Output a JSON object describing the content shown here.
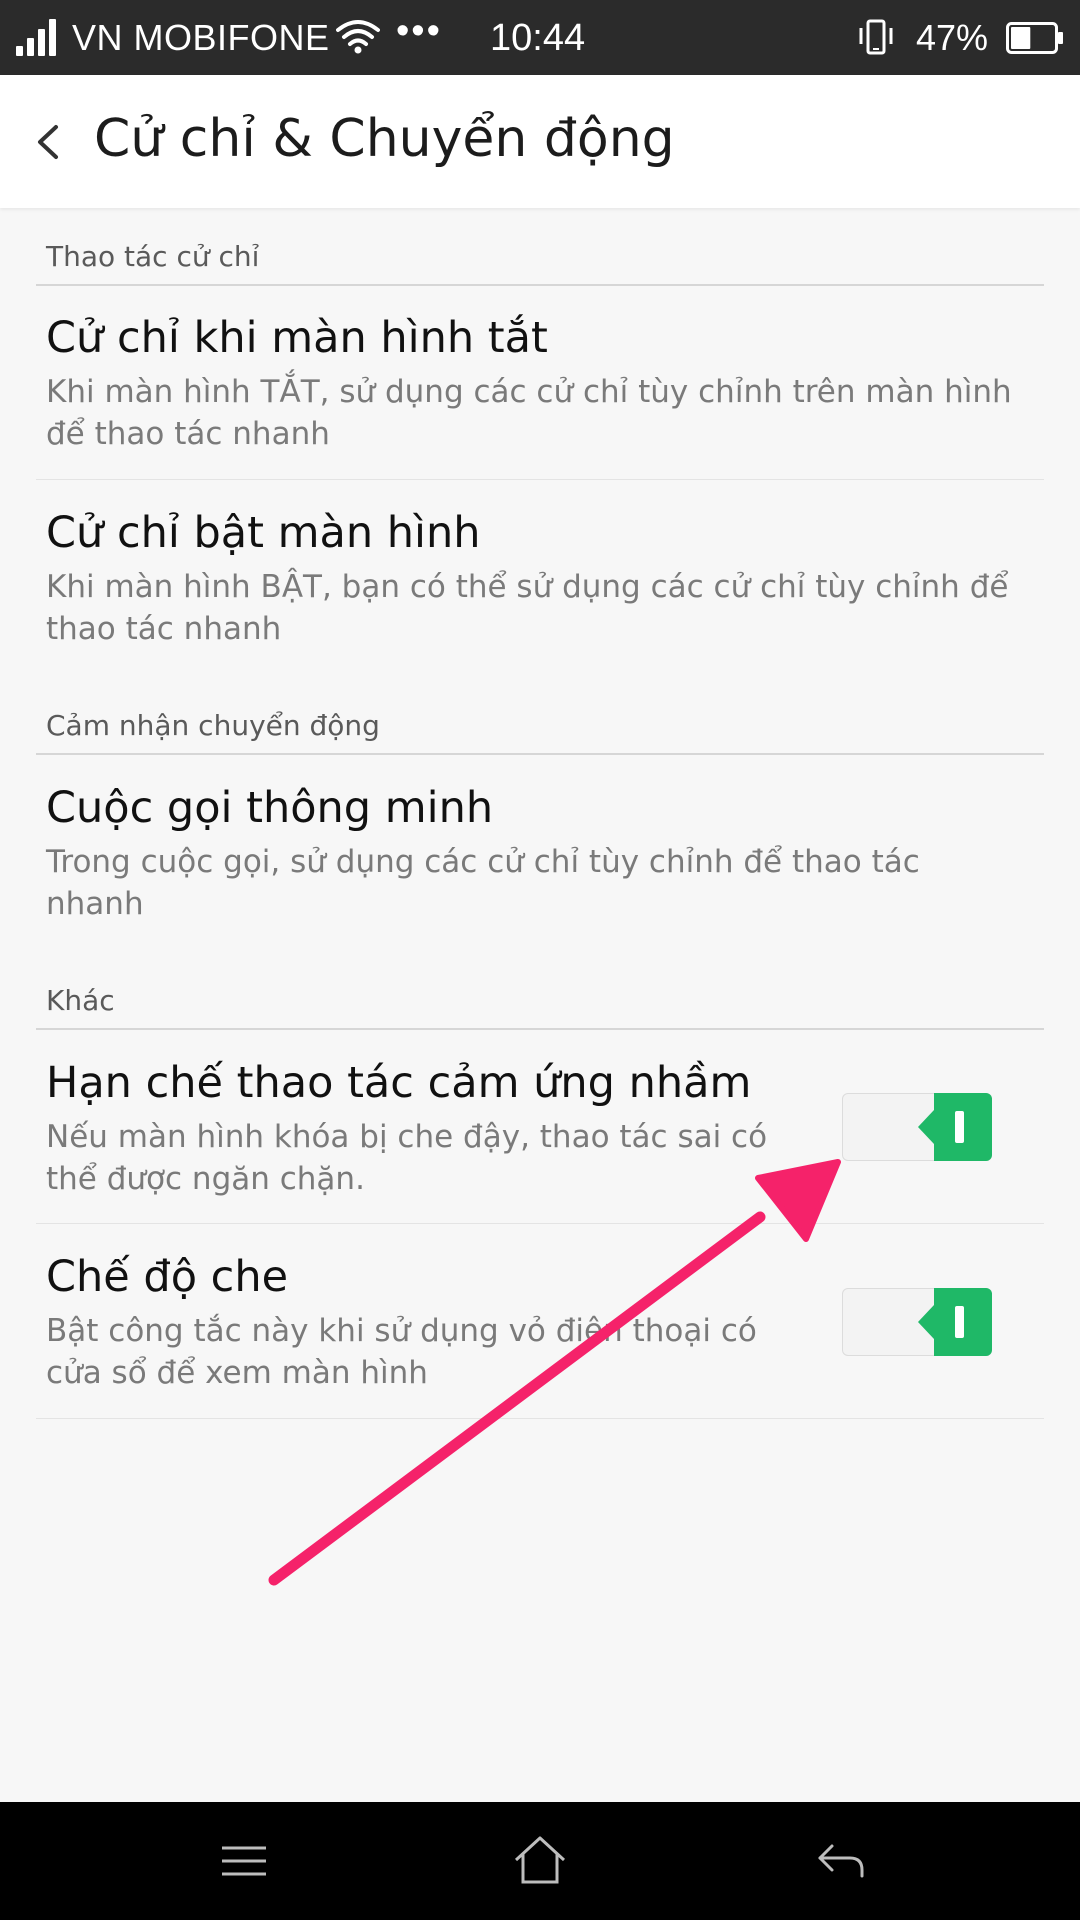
{
  "status_bar": {
    "carrier": "VN MOBIFONE",
    "dots": "•••",
    "time": "10:44",
    "battery_percent": "47%",
    "battery_level": 0.47,
    "icons": [
      "signal-icon",
      "wifi-icon",
      "vibrate-icon",
      "battery-icon"
    ]
  },
  "header": {
    "back_icon": "chevron-left-icon",
    "title": "Cử chỉ & Chuyển động"
  },
  "sections": [
    {
      "header": "Thao tác cử chỉ",
      "items": [
        {
          "title": "Cử chỉ khi màn hình tắt",
          "desc_line1": "Khi màn hình TẮT, sử dụng các cử chỉ tùy chỉnh trên màn hình",
          "desc_line2": "để thao tác nhanh"
        },
        {
          "title": "Cử chỉ bật màn hình",
          "desc_line1": "Khi màn hình BẬT, bạn có thể sử dụng các cử chỉ tùy chỉnh để",
          "desc_line2": "thao tác nhanh"
        }
      ]
    },
    {
      "header": "Cảm nhận chuyển động",
      "items": [
        {
          "title": "Cuộc gọi thông minh",
          "desc_line1": "Trong cuộc gọi, sử dụng các cử chỉ tùy chỉnh để thao tác",
          "desc_line2": "nhanh"
        }
      ]
    },
    {
      "header": "Khác",
      "items": [
        {
          "title": "Hạn chế thao tác cảm ứng nhầm",
          "desc_line1": "Nếu màn hình khóa bị che đậy, thao tác sai có",
          "desc_line2": "thể được ngăn chặn.",
          "toggle_on": true
        },
        {
          "title": "Chế độ che",
          "desc_line1": "Bật công tắc này khi sử dụng vỏ điện thoại có",
          "desc_line2": "cửa sổ để xem màn hình",
          "toggle_on": true
        }
      ]
    }
  ],
  "colors": {
    "toggle_on": "#1fb867",
    "annotation_arrow": "#f5226a",
    "status_bar_bg": "#2b2b2b",
    "nav_bar_bg": "#000000"
  },
  "nav_bar": {
    "icons": [
      "menu-icon",
      "home-icon",
      "back-icon"
    ]
  }
}
